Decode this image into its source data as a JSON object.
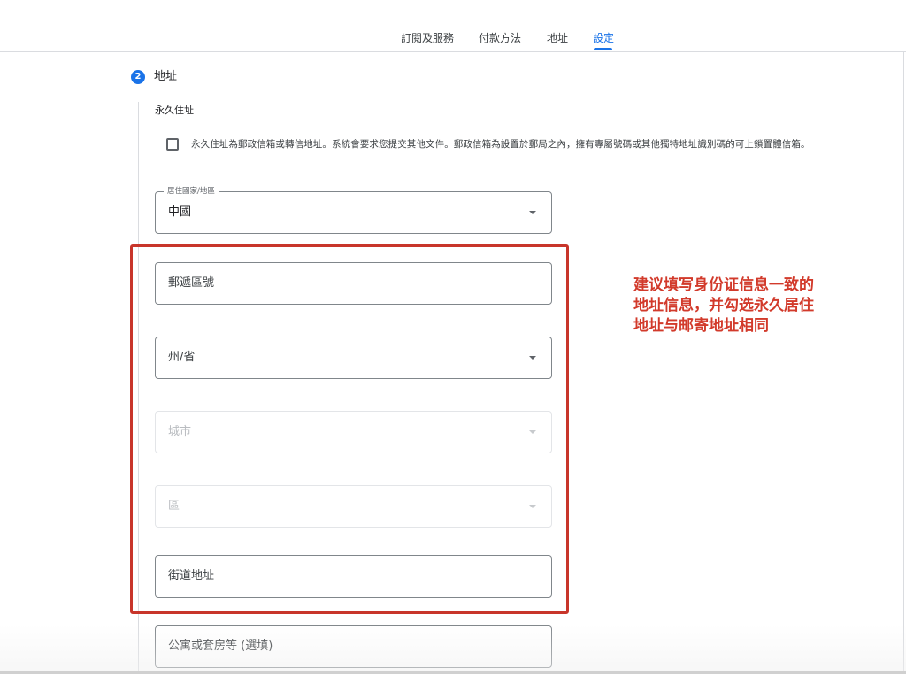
{
  "tabs": [
    {
      "label": "訂閱及服務",
      "active": false
    },
    {
      "label": "付款方法",
      "active": false
    },
    {
      "label": "地址",
      "active": false
    },
    {
      "label": "設定",
      "active": true
    }
  ],
  "step": {
    "number": "2",
    "title": "地址"
  },
  "section": {
    "label": "永久住址"
  },
  "checkbox": {
    "checked": false,
    "text": "永久住址為郵政信箱或轉信地址。系統會要求您提交其他文件。郵政信箱為設置於郵局之內，擁有專屬號碼或其他獨特地址識別碼的可上鎖置體信箱。"
  },
  "fields": {
    "country": {
      "label": "居住國家/地區",
      "value": "中國"
    },
    "postal": {
      "placeholder": "郵遞區號"
    },
    "province": {
      "placeholder": "州/省"
    },
    "city": {
      "placeholder": "城市"
    },
    "district": {
      "placeholder": "區"
    },
    "street": {
      "placeholder": "街道地址"
    },
    "apartment": {
      "placeholder": "公寓或套房等 (選填)"
    }
  },
  "annotation": {
    "lines": [
      "建议填写身份证信息一致的",
      "地址信息，并勾选永久居住",
      "地址与邮寄地址相同"
    ]
  },
  "colors": {
    "accent": "#1a73e8",
    "annotation_red": "#c8352a"
  }
}
